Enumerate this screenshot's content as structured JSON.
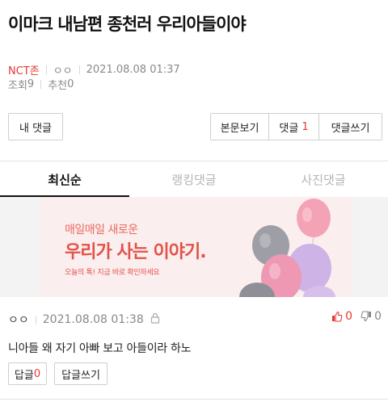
{
  "post": {
    "title": "이마크 내남편 종천러 우리아들이야",
    "board": "NCT존",
    "author": "ㅇㅇ",
    "date": "2021.08.08 01:37",
    "views_label": "조회",
    "views": "9",
    "recommend_label": "추천",
    "recommend": "0"
  },
  "actions": {
    "my_comments": "내 댓글",
    "view_body": "본문보기",
    "comments_label": "댓글",
    "comments_count": "1",
    "write_comment": "댓글쓰기"
  },
  "tabs": [
    {
      "label": "최신순",
      "active": true
    },
    {
      "label": "랭킹댓글",
      "active": false
    },
    {
      "label": "사진댓글",
      "active": false
    }
  ],
  "banner": {
    "line1": "매일매일 새로운",
    "line2": "우리가 사는 이야기.",
    "line3": "오늘의 톡! 지금 바로 확인하세요"
  },
  "comment": {
    "author": "ㅇㅇ",
    "date": "2021.08.08 01:38",
    "text": "니아들 왜 자기 아빠 보고 아들이라 하노",
    "upvotes": "0",
    "downvotes": "0",
    "reply_label": "답글",
    "reply_count": "0",
    "write_reply": "답글쓰기"
  },
  "colors": {
    "accent": "#e53935",
    "muted": "#888888",
    "border": "#cfcfcf"
  },
  "icons": [
    "lock-icon",
    "thumbs-up-icon",
    "thumbs-down-icon",
    "balloon-image"
  ]
}
